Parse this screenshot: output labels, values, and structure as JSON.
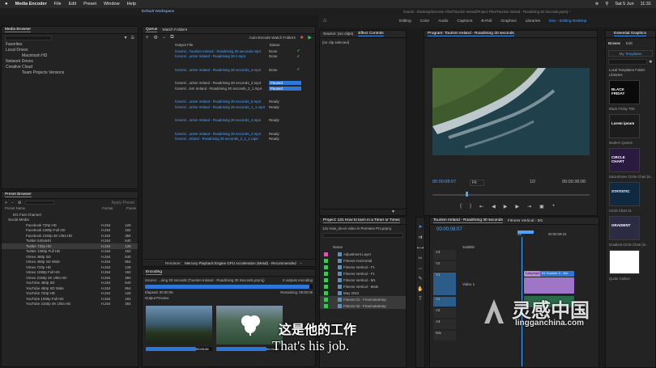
{
  "menubar": {
    "app": "Media Encoder",
    "items": [
      "File",
      "Edit",
      "Preset",
      "Window",
      "Help"
    ],
    "date": "Sat 5 Jun",
    "time": "11:31"
  },
  "title_left": "Default Workspace",
  "path_right": "/Users/.../Desktop/Exercise Files/Tourism Ireland/Project Files/Tourism Ireland - Roadrising 30 Seconds.prproj *",
  "pr_nav": {
    "items": [
      "Editing",
      "Color",
      "Audio",
      "Captions",
      "B-Roll",
      "Graphics",
      "Libraries"
    ],
    "active": "Dev - Editing Desktop"
  },
  "media_browser": {
    "title": "Media Browser",
    "items": [
      "Favorites",
      "Local Drives",
      "Macintosh HD",
      "Network Drives",
      "Creative Cloud",
      "Team Projects Versions"
    ]
  },
  "queue": {
    "tabs": [
      "Queue",
      "Watch Folders"
    ],
    "auto_encode": "Auto-Encode Watch Folders",
    "col_output": "Output File",
    "col_status": "Status",
    "rows": [
      {
        "file": "/Users/...Tourism Ireland - Roadrising 30 seconds.mp4",
        "status": "Done",
        "blue": true
      },
      {
        "file": "/Users/...urism Ireland - Roadrising 30 s.mp4",
        "status": "Done",
        "blue": true
      },
      {
        "file": "/Users/...urism Ireland - Roadrising 30 seconds_3.mp4",
        "status": "Done",
        "blue": true
      },
      {
        "file": "/Users/...urism Ireland - Roadrising 30 seconds_2.mp4",
        "status": "Paused",
        "blue": false
      },
      {
        "file": "/Users/...ism Ireland - Roadrising 30 seconds_2_1.mp4",
        "status": "Paused",
        "blue": false
      },
      {
        "file": "/Users/...urism Ireland - Roadrising 30 seconds_5.mp4",
        "status": "Ready",
        "blue": true
      },
      {
        "file": "/Users/...urism Ireland - Roadrising 30 seconds_1_1.mp4",
        "status": "Ready",
        "blue": true
      },
      {
        "file": "/Users/...urism Ireland - Roadrising 30 seconds_4.mp4",
        "status": "Ready",
        "blue": true
      },
      {
        "file": "/Users/...urism Ireland - Roadrising 30 seconds_2.mp4",
        "status": "Ready",
        "blue": true
      },
      {
        "file": "/Users/...reland - Roadrising 30 seconds_2_1_1.mp4",
        "status": "Ready",
        "blue": true
      }
    ],
    "renderer_label": "Renderer:",
    "renderer": "Mercury Playback Engine GPU Acceleration (Metal) - Recommended"
  },
  "preset_browser": {
    "title": "Preset Browser",
    "apply": "Apply Preset",
    "columns": [
      "Preset Name",
      "Format",
      "Frame"
    ],
    "groups": [
      "DG Fast Channel",
      "Social Media"
    ],
    "rows": [
      [
        "Facebook 720p HD",
        "H.264",
        "128"
      ],
      [
        "Facebook 1080p Full HD",
        "H.264",
        "192"
      ],
      [
        "Facebook 2160p 4K Ultra HD",
        "H.264",
        "384"
      ],
      [
        "Twitter 640x640",
        "H.264",
        "640"
      ],
      [
        "Twitter 720p HD",
        "H.264",
        "128"
      ],
      [
        "Twitter 1080p Full HD",
        "H.264",
        "192"
      ],
      [
        "Vimeo 480p SD",
        "H.264",
        "640"
      ],
      [
        "Vimeo 480p SD Wide",
        "H.264",
        "854"
      ],
      [
        "Vimeo 720p HD",
        "H.264",
        "128"
      ],
      [
        "Vimeo 1080p Full HD",
        "H.264",
        "192"
      ],
      [
        "Vimeo 2160p 4K Ultra HD",
        "H.264",
        "384"
      ],
      [
        "YouTube 480p SD",
        "H.264",
        "640"
      ],
      [
        "YouTube 480p SD Wide",
        "H.264",
        "854"
      ],
      [
        "YouTube 720p HD",
        "H.264",
        "128"
      ],
      [
        "YouTube 1080p Full HD",
        "H.264",
        "192"
      ],
      [
        "YouTube 2160p 4K Ultra HD",
        "H.264",
        "384"
      ]
    ]
  },
  "encoding": {
    "title": "Encoding",
    "source": "Source: ...sing 30 seconds (Tourism Ireland - Roadrising 30 Seconds.prproj)",
    "outputs": "2 outputs encoding",
    "elapsed": "Elapsed: 00:00:06",
    "remaining": "Remaining: 00:00:06",
    "preview": "Output Preview",
    "progress": 0.98,
    "t1": "00:00:06",
    "t2": "00:00:06"
  },
  "source_panel": {
    "tabs": [
      "Source: (no clips)",
      "Effect Controls"
    ],
    "no_clip": "(no clip selected)"
  },
  "program": {
    "title": "Program: Tourism Ireland - Roadrising 30 seconds",
    "tc_left": "00:00:08:07",
    "fit": "Fit",
    "quality": "1/2",
    "tc_right": "00:00:36:00"
  },
  "essential_graphics": {
    "title": "Essential Graphics",
    "tabs": [
      "Browse",
      "Edit"
    ],
    "my_templates": "My Templates",
    "local": "Local Templates Folder",
    "libraries": "Libraries",
    "templates": [
      {
        "name": "Black Friday Title",
        "tile": "BLACK FRIDAY"
      },
      {
        "name": "Modern Quotes",
        "tile": "Lorem ipsum"
      },
      {
        "name": "Data-Driven Circle Chart (in...",
        "tile": "CIRCLE CHART"
      },
      {
        "name": "Circle Chart 01",
        "tile": "STATISTIC"
      },
      {
        "name": "Gradient Circle Chart (in...",
        "tile": "GRADIENT"
      },
      {
        "name": "Quote Callout",
        "tile": ""
      }
    ]
  },
  "project": {
    "title": "Project: 131 How to burn in a Timer or Timec",
    "file": "131 How_do-en video in Premiere Pro.prproj",
    "col": "Name",
    "items": [
      "Adjustment Layer",
      "Fitness Horizontal",
      "Fitness Vertical - F1",
      "Fitness Vertical - F1",
      "Fitness Vertical - M1",
      "Fitness Vertical - Male",
      "May 2022",
      "Fitness 01 - Freemotetemp",
      "Fitness 02 - Freemotetemp"
    ]
  },
  "timeline": {
    "tabs": [
      "Tourism Ireland - Roadrising 30 seconds",
      "Fitness Vertical - M1"
    ],
    "tc": "00:00:08:07",
    "ruler": [
      "25",
      "00:00:09:23"
    ],
    "tracks": [
      "V3",
      "V2",
      "V1",
      "A1",
      "A2",
      "A3",
      "Mix"
    ],
    "video1": "Video 1",
    "clip": "Lazy.mp4",
    "clip2": "01 Tourism 2 - Wo",
    "subtitle": "Subtitle"
  },
  "subtitle": {
    "zh": "这是他的工作",
    "en": "That's his job."
  },
  "watermark": {
    "zh": "灵感中国",
    "en": "lingganchina.com"
  },
  "colors": {
    "accent": "#2c77d8",
    "done": "#3ec45a",
    "timeline_clip": "#b68ad8"
  }
}
